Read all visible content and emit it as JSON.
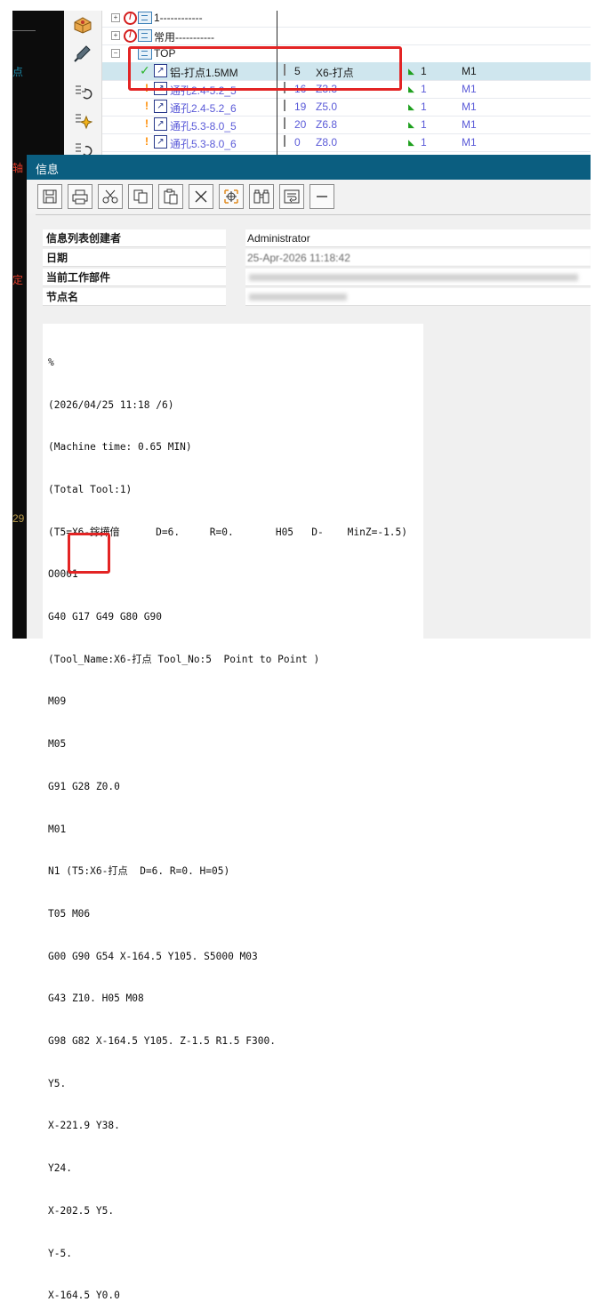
{
  "left_strip": {
    "chars": [
      "点",
      "轴",
      "定",
      "29"
    ]
  },
  "tree": {
    "rows": [
      {
        "label": "1------------",
        "kind": "group"
      },
      {
        "label": "常用-----------",
        "kind": "group"
      },
      {
        "label": "TOP",
        "kind": "group"
      },
      {
        "label": "铝-打点1.5MM",
        "tool_no": "5",
        "tool": "X6-打点",
        "num": "1",
        "machine": "M1",
        "selected": true
      },
      {
        "label": "通孔2.4-5.2_5",
        "tool_no": "16",
        "tool": "Z3.3",
        "num": "1",
        "machine": "M1"
      },
      {
        "label": "通孔2.4-5.2_6",
        "tool_no": "19",
        "tool": "Z5.0",
        "num": "1",
        "machine": "M1"
      },
      {
        "label": "通孔5.3-8.0_5",
        "tool_no": "20",
        "tool": "Z6.8",
        "num": "1",
        "machine": "M1"
      },
      {
        "label": "通孔5.3-8.0_6",
        "tool_no": "0",
        "tool": "Z8.0",
        "num": "1",
        "machine": "M1"
      }
    ]
  },
  "info_window": {
    "title": "信息",
    "toolbar": [
      "save-icon",
      "print-icon",
      "cut-icon",
      "copy-icon",
      "paste-icon",
      "delete-icon",
      "locate-icon",
      "find-icon",
      "wrap-icon",
      "minimize-icon"
    ],
    "table": [
      {
        "key": "信息列表创建者",
        "value": "Administrator"
      },
      {
        "key": "日期",
        "value": "25-Apr-2026 11:18:42"
      },
      {
        "key": "当前工作部件",
        "value": ""
      },
      {
        "key": "节点名",
        "value": ""
      }
    ],
    "code_lines": [
      "%",
      "(2026/04/25 11:18 /6)",
      "(Machine time: 0.65 MIN)",
      "(Total Tool:1)",
      "(T5=X6-鎵撶偣      D=6.     R=0.       H05   D-    MinZ=-1.5)",
      "O0001",
      "G40 G17 G49 G80 G90",
      "(Tool_Name:X6-打点 Tool_No:5  Point to Point )",
      "M09",
      "M05",
      "G91 G28 Z0.0",
      "M01",
      "N1 (T5:X6-打点  D=6. R=0. H=05)",
      "T05 M06",
      "G00 G90 G54 X-164.5 Y105. S5000 M03",
      "G43 Z10. H05 M08",
      "G98 G82 X-164.5 Y105. Z-1.5 R1.5 F300.",
      "Y5.",
      "X-221.9 Y38.",
      "Y24.",
      "X-202.5 Y5.",
      "Y-5.",
      "X-164.5 Y0.0"
    ]
  },
  "colors": {
    "title_bar": "#0b5e80",
    "highlight_red": "#e32424",
    "selected_row": "#cfe6ee"
  }
}
